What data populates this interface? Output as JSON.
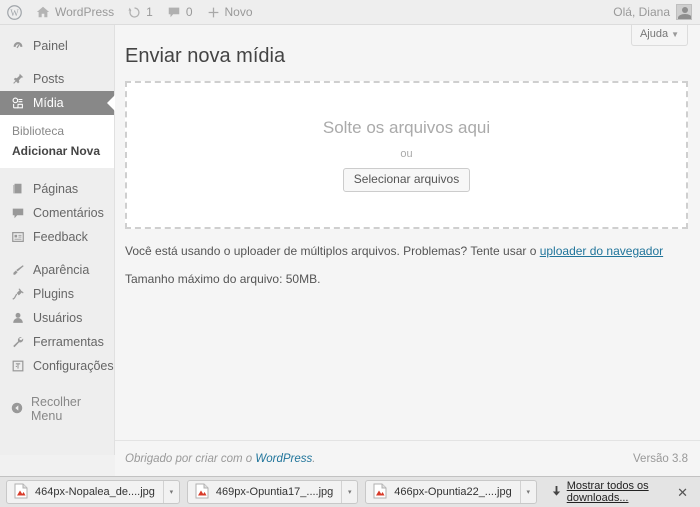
{
  "adminbar": {
    "logo_icon": "wordpress-logo-icon",
    "site_name": "WordPress",
    "site_icon": "home-icon",
    "updates_icon": "updates-icon",
    "updates_count": "1",
    "comments_icon": "comment-bubble-icon",
    "comments_count": "0",
    "new_icon": "plus-icon",
    "new_label": "Novo",
    "greeting": "Olá, Diana",
    "avatar_icon": "avatar-icon"
  },
  "sidebar": {
    "items": [
      {
        "label": "Painel",
        "icon": "dashboard-icon",
        "current": false
      },
      {
        "label": "Posts",
        "icon": "pin-icon",
        "current": false
      },
      {
        "label": "Mídia",
        "icon": "media-icon",
        "current": true
      },
      {
        "label": "Páginas",
        "icon": "pages-icon",
        "current": false
      },
      {
        "label": "Comentários",
        "icon": "comment-bubble-icon",
        "current": false
      },
      {
        "label": "Feedback",
        "icon": "feedback-icon",
        "current": false
      },
      {
        "label": "Aparência",
        "icon": "appearance-brush-icon",
        "current": false
      },
      {
        "label": "Plugins",
        "icon": "plugins-plug-icon",
        "current": false
      },
      {
        "label": "Usuários",
        "icon": "users-icon",
        "current": false
      },
      {
        "label": "Ferramentas",
        "icon": "tools-wrench-icon",
        "current": false
      },
      {
        "label": "Configurações",
        "icon": "settings-gear-icon",
        "current": false
      }
    ],
    "submenu": [
      {
        "label": "Biblioteca",
        "current": false
      },
      {
        "label": "Adicionar Nova",
        "current": true
      }
    ],
    "collapse": {
      "label": "Recolher Menu",
      "icon": "collapse-arrow-icon"
    }
  },
  "content": {
    "help_label": "Ajuda",
    "help_caret": "▼",
    "title": "Enviar nova mídia",
    "dropzone": {
      "title": "Solte os arquivos aqui",
      "or": "ou",
      "button": "Selecionar arquivos"
    },
    "notes": {
      "multi_prefix": "Você está usando o uploader de múltiplos arquivos. Problemas? Tente usar o ",
      "multi_link": "uploader do navegador",
      "max_size": "Tamanho máximo do arquivo: 50MB."
    }
  },
  "footer": {
    "thanks_prefix": "Obrigado por criar com o ",
    "thanks_link": "WordPress",
    "thanks_suffix": ".",
    "version": "Versão 3.8"
  },
  "downloads": {
    "items": [
      {
        "name": "464px-Nopalea_de....jpg",
        "icon": "image-file-icon",
        "caret": "▾"
      },
      {
        "name": "469px-Opuntia17_....jpg",
        "icon": "image-file-icon",
        "caret": "▾"
      },
      {
        "name": "466px-Opuntia22_....jpg",
        "icon": "image-file-icon",
        "caret": "▾"
      }
    ],
    "show_all": "Mostrar todos os downloads...",
    "show_all_icon": "download-arrow-icon",
    "close": "✕"
  },
  "colors": {
    "accent_link": "#21759b",
    "active_menu_bg": "#888888",
    "chrome_bg": "#eeeeee"
  }
}
